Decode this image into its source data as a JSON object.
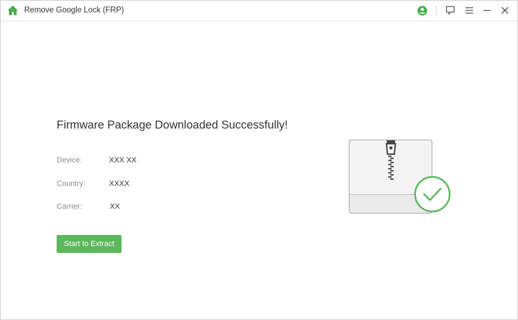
{
  "window": {
    "title": "Remove Google Lock (FRP)",
    "icons": [
      "home-icon",
      "account-icon",
      "feedback-icon",
      "menu-icon",
      "minimize-icon",
      "close-icon"
    ]
  },
  "main": {
    "headline": "Firmware Package Downloaded Successfully!",
    "fields": [
      {
        "label": "Device:",
        "value": "XXX XX"
      },
      {
        "label": "Country:",
        "value": "XXXX"
      },
      {
        "label": "Carrier:",
        "value": "XX"
      }
    ],
    "extract_button_label": "Start to Extract"
  },
  "colors": {
    "accent_green": "#5cb85c",
    "text_dark": "#333333",
    "label_gray": "#8a8a8a"
  }
}
